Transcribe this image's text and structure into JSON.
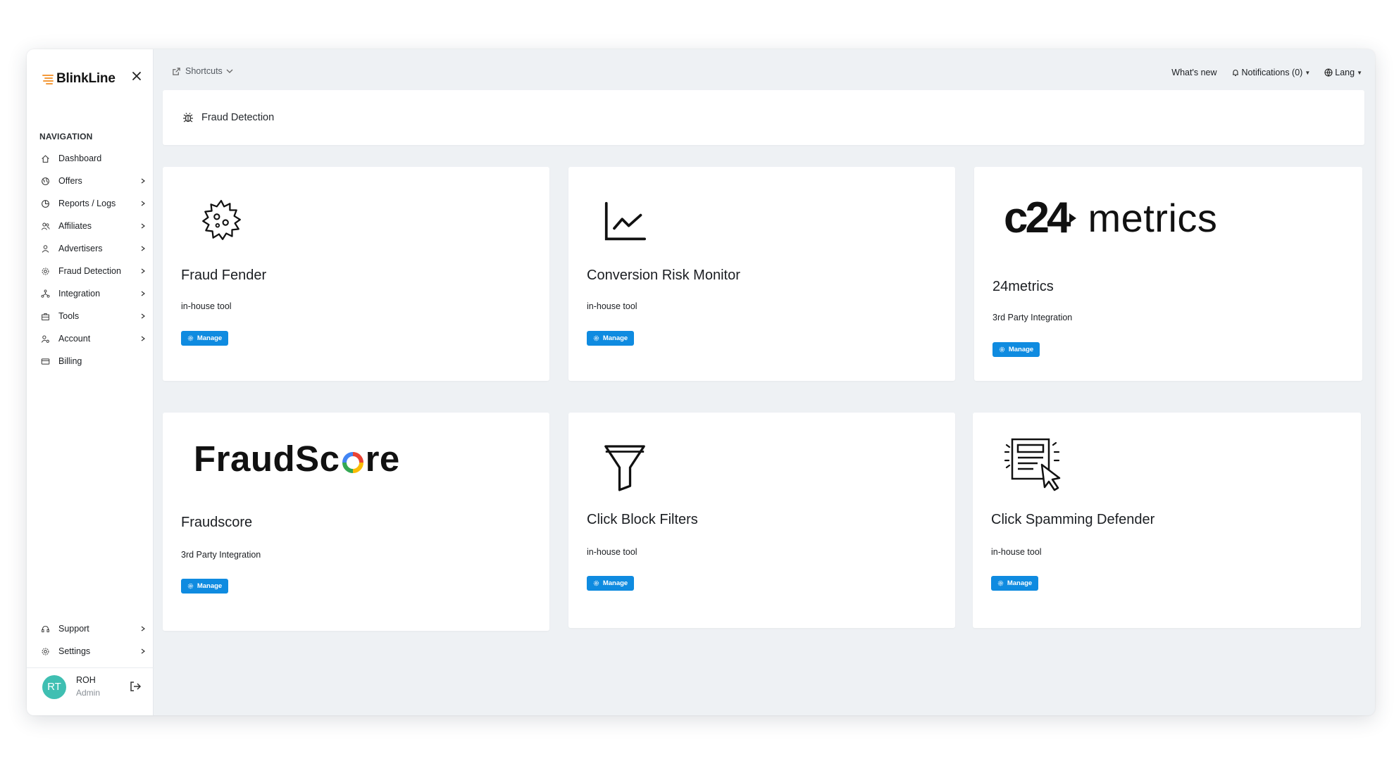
{
  "app": {
    "brand": "BlinkLine"
  },
  "sidebar": {
    "nav_heading": "NAVIGATION",
    "items": [
      {
        "label": "Dashboard",
        "icon": "home-icon",
        "has_children": false
      },
      {
        "label": "Offers",
        "icon": "globe-icon",
        "has_children": true
      },
      {
        "label": "Reports / Logs",
        "icon": "pie-chart-icon",
        "has_children": true
      },
      {
        "label": "Affiliates",
        "icon": "users-icon",
        "has_children": true
      },
      {
        "label": "Advertisers",
        "icon": "user-icon",
        "has_children": true
      },
      {
        "label": "Fraud Detection",
        "icon": "gear-icon",
        "has_children": true
      },
      {
        "label": "Integration",
        "icon": "network-icon",
        "has_children": true
      },
      {
        "label": "Tools",
        "icon": "toolbox-icon",
        "has_children": true
      },
      {
        "label": "Account",
        "icon": "user-settings-icon",
        "has_children": true
      },
      {
        "label": "Billing",
        "icon": "card-icon",
        "has_children": false
      }
    ],
    "bottom_items": [
      {
        "label": "Support",
        "icon": "headset-icon"
      },
      {
        "label": "Settings",
        "icon": "gear-icon"
      }
    ],
    "user": {
      "initials": "RT",
      "name": "ROH",
      "role": "Admin"
    }
  },
  "topbar": {
    "shortcuts": "Shortcuts",
    "whats_new": "What's new",
    "notifications": "Notifications (0)",
    "lang": "Lang"
  },
  "page": {
    "title": "Fraud Detection"
  },
  "tools": [
    {
      "title": "Fraud Fender",
      "desc": "in-house tool",
      "button": "Manage",
      "icon": "virus-icon"
    },
    {
      "title": "Conversion Risk Monitor",
      "desc": "in-house tool",
      "button": "Manage",
      "icon": "line-chart-icon"
    },
    {
      "title": "24metrics",
      "desc": "3rd Party Integration",
      "button": "Manage",
      "logo_main": "c24",
      "logo_suffix": "metrics"
    },
    {
      "title": "Fraudscore",
      "desc": "3rd Party Integration",
      "button": "Manage",
      "logo_a": "FraudSc",
      "logo_b": "re"
    },
    {
      "title": "Click Block Filters",
      "desc": "in-house tool",
      "button": "Manage",
      "icon": "filter-icon"
    },
    {
      "title": "Click Spamming Defender",
      "desc": "in-house tool",
      "button": "Manage",
      "icon": "click-cursor-icon"
    }
  ],
  "colors": {
    "accent": "#0f8be0",
    "avatar": "#3fbfb2",
    "logo_orange": "#f39a3b",
    "background": "#eef1f4"
  }
}
